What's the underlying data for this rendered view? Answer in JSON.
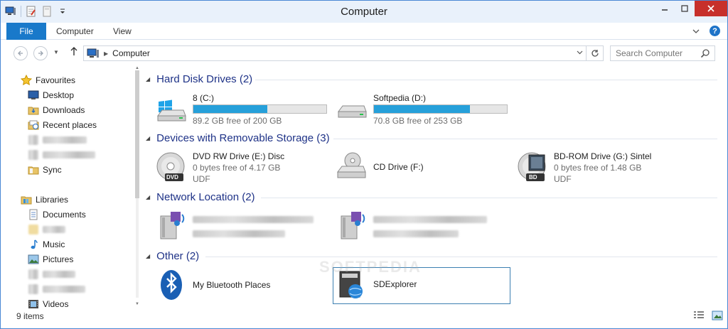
{
  "window": {
    "title": "Computer"
  },
  "ribbon": {
    "file_tab": "File",
    "computer_tab": "Computer",
    "view_tab": "View"
  },
  "address": {
    "crumb": "Computer"
  },
  "search": {
    "placeholder": "Search Computer"
  },
  "navpane": {
    "favourites": "Favourites",
    "desktop": "Desktop",
    "downloads": "Downloads",
    "recent_places": "Recent places",
    "sync": "Sync",
    "libraries": "Libraries",
    "documents": "Documents",
    "music": "Music",
    "pictures": "Pictures",
    "videos": "Videos"
  },
  "groups": {
    "hard_disks": "Hard Disk Drives (2)",
    "removable": "Devices with Removable Storage (3)",
    "network": "Network Location (2)",
    "other": "Other (2)"
  },
  "drives": [
    {
      "name": "8 (C:)",
      "free": "89.2 GB free of 200 GB",
      "used_fraction": 0.554
    },
    {
      "name": "Softpedia (D:)",
      "free": "70.8 GB free of 253 GB",
      "used_fraction": 0.72
    }
  ],
  "removable": [
    {
      "name": "DVD RW Drive (E:) Disc",
      "free": "0 bytes free of 4.17 GB",
      "fs": "UDF",
      "label": "DVD"
    },
    {
      "name": "CD Drive (F:)"
    },
    {
      "name": "BD-ROM Drive (G:) Sintel",
      "free": "0 bytes free of 1.48 GB",
      "fs": "UDF",
      "label": "BD"
    }
  ],
  "other": [
    {
      "name": "My Bluetooth Places"
    },
    {
      "name": "SDExplorer"
    }
  ],
  "watermark": "SOFTPEDIA",
  "status": {
    "count": "9 items"
  },
  "colors": {
    "accent": "#1979ca",
    "bar_fill": "#26a0da",
    "group_header": "#1e3287",
    "close": "#c7302b"
  }
}
